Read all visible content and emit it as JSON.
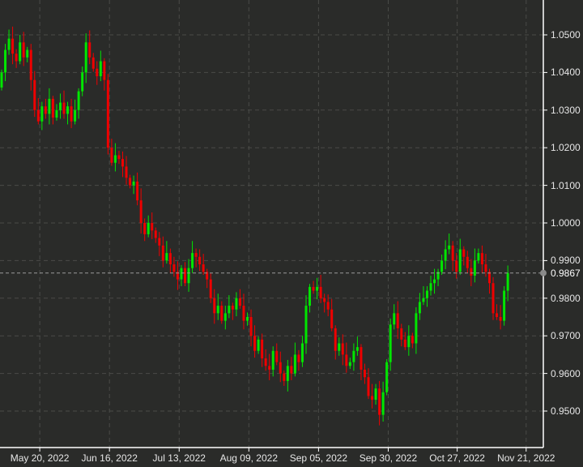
{
  "chart_data": {
    "type": "candlestick",
    "title": "",
    "xlabel": "",
    "ylabel": "",
    "ylim": [
      0.9415,
      1.059
    ],
    "grid": true,
    "y_ticks": [
      "1.0500",
      "1.0400",
      "1.0300",
      "1.0200",
      "1.0100",
      "1.0000",
      "0.9900",
      "0.9800",
      "0.9700",
      "0.9600",
      "0.9500"
    ],
    "y_tick_values": [
      1.05,
      1.04,
      1.03,
      1.02,
      1.01,
      1.0,
      0.99,
      0.98,
      0.97,
      0.96,
      0.95
    ],
    "x_ticks": [
      "May 20, 2022",
      "Jun 16, 2022",
      "Jul 13, 2022",
      "Aug 09, 2022",
      "Sep 05, 2022",
      "Sep 30, 2022",
      "Oct 27, 2022",
      "Nov 21, 2022"
    ],
    "x_tick_index": [
      10.4,
      29.4,
      48.4,
      67.4,
      86.4,
      105.4,
      124.2,
      143.0
    ],
    "current_price": 0.9867,
    "current_price_label": "0.9867",
    "first_open": 1.036,
    "closes": [
      1.04,
      1.046,
      1.049,
      1.045,
      1.043,
      1.048,
      1.044,
      1.046,
      1.038,
      1.03,
      1.027,
      1.031,
      1.029,
      1.033,
      1.028,
      1.03,
      1.032,
      1.029,
      1.031,
      1.027,
      1.03,
      1.035,
      1.04,
      1.048,
      1.044,
      1.041,
      1.039,
      1.043,
      1.038,
      1.02,
      1.016,
      1.018,
      1.017,
      1.015,
      1.012,
      1.01,
      1.011,
      1.006,
      1.0,
      0.997,
      1.0,
      0.998,
      0.996,
      0.994,
      0.99,
      0.992,
      0.989,
      0.987,
      0.985,
      0.988,
      0.984,
      0.988,
      0.992,
      0.991,
      0.989,
      0.987,
      0.985,
      0.98,
      0.976,
      0.978,
      0.974,
      0.976,
      0.978,
      0.977,
      0.98,
      0.978,
      0.974,
      0.975,
      0.97,
      0.966,
      0.969,
      0.964,
      0.962,
      0.961,
      0.966,
      0.963,
      0.96,
      0.958,
      0.962,
      0.96,
      0.965,
      0.963,
      0.968,
      0.978,
      0.983,
      0.982,
      0.983,
      0.98,
      0.979,
      0.977,
      0.972,
      0.966,
      0.968,
      0.965,
      0.962,
      0.963,
      0.966,
      0.967,
      0.961,
      0.959,
      0.954,
      0.953,
      0.956,
      0.949,
      0.955,
      0.963,
      0.973,
      0.976,
      0.972,
      0.969,
      0.967,
      0.97,
      0.968,
      0.976,
      0.979,
      0.98,
      0.982,
      0.984,
      0.985,
      0.987,
      0.99,
      0.993,
      0.994,
      0.99,
      0.987,
      0.993,
      0.991,
      0.988,
      0.986,
      0.99,
      0.992,
      0.989,
      0.987,
      0.984,
      0.976,
      0.975,
      0.974,
      0.982,
      0.9867
    ],
    "colors": {
      "up": "#00e600",
      "down": "#ee0000",
      "background": "#2a2b29",
      "grid": "#4a4b48",
      "axis": "#ffffff",
      "price_line": "#9a9a9a"
    }
  }
}
